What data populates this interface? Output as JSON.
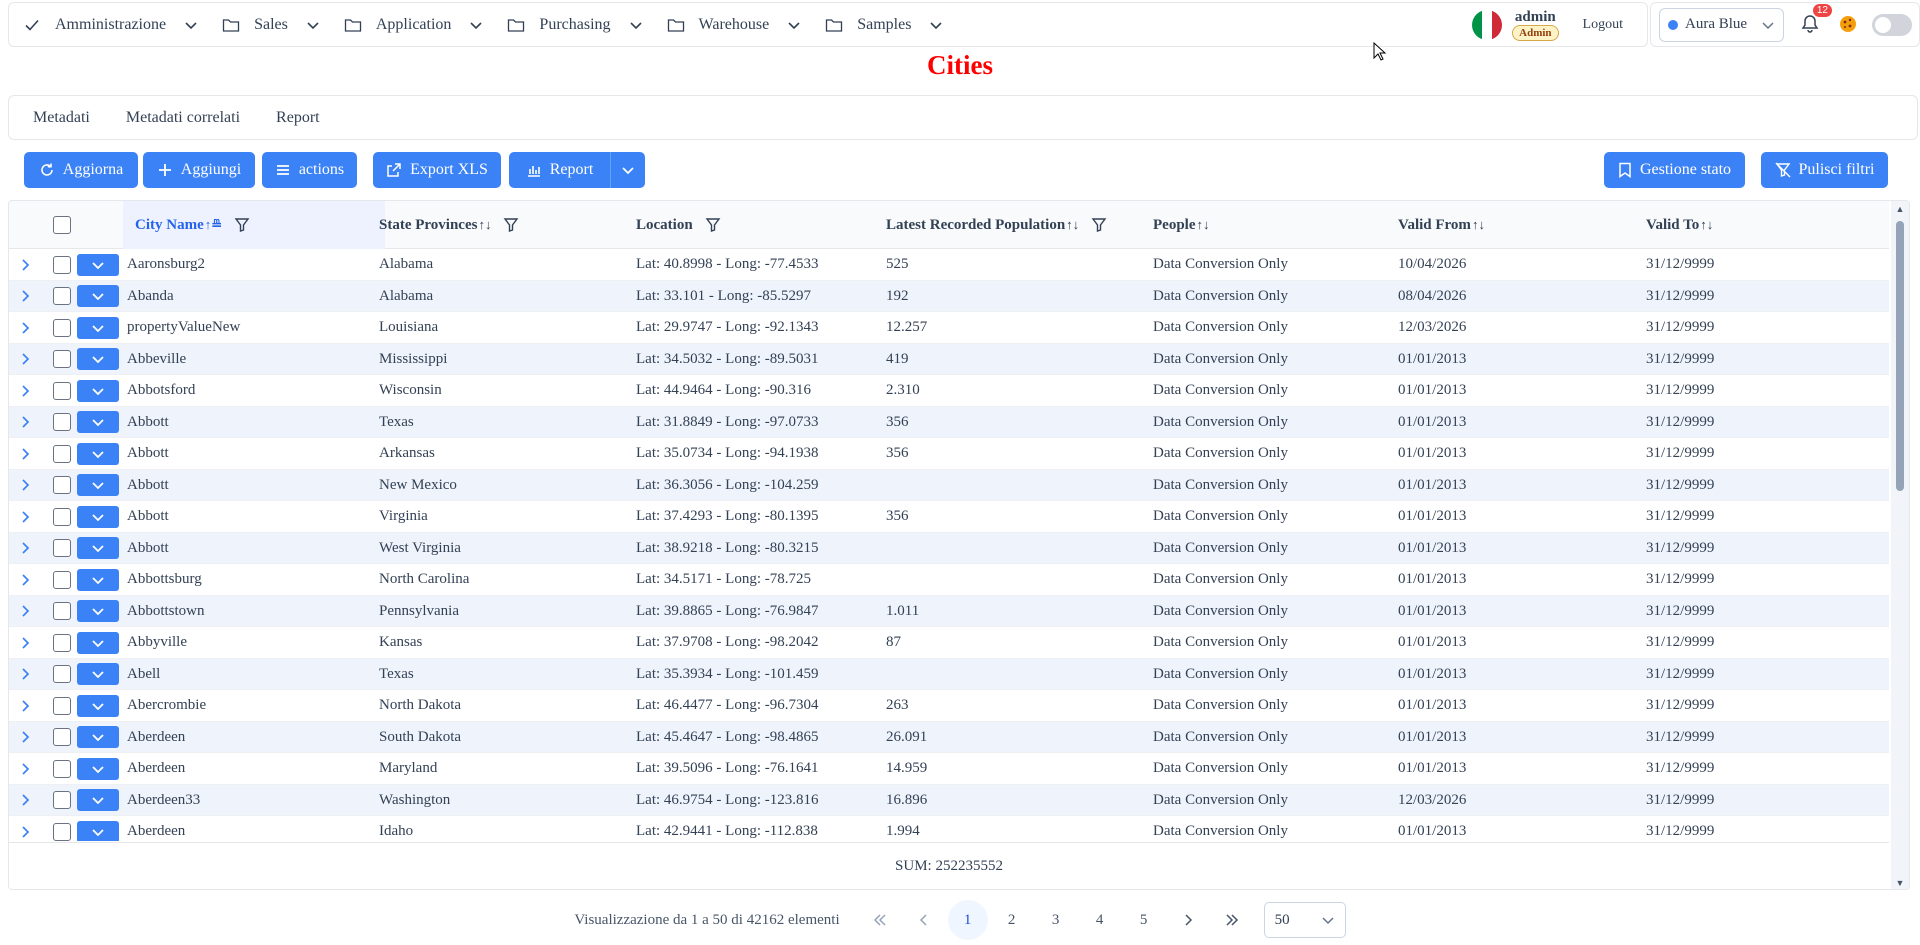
{
  "nav": {
    "items": [
      {
        "label": "Amministrazione",
        "icon": "check-icon"
      },
      {
        "label": "Sales",
        "icon": "folder-icon"
      },
      {
        "label": "Application",
        "icon": "folder-icon"
      },
      {
        "label": "Purchasing",
        "icon": "folder-icon"
      },
      {
        "label": "Warehouse",
        "icon": "folder-icon"
      },
      {
        "label": "Samples",
        "icon": "folder-icon"
      }
    ],
    "user": "admin",
    "role": "Admin",
    "logout": "Logout",
    "theme": "Aura Blue",
    "notifications": "12"
  },
  "page": {
    "title": "Cities"
  },
  "tabs": [
    "Metadati",
    "Metadati correlati",
    "Report"
  ],
  "toolbar": {
    "refresh": "Aggiorna",
    "add": "Aggiungi",
    "actions": "actions",
    "export": "Export XLS",
    "report": "Report",
    "state": "Gestione stato",
    "clear": "Pulisci filtri"
  },
  "columns": {
    "city": "City Name",
    "state": "State Provinces",
    "location": "Location",
    "population": "Latest Recorded Population",
    "people": "People",
    "valid_from": "Valid From",
    "valid_to": "Valid To"
  },
  "rows": [
    [
      "Aaronsburg2",
      "Alabama",
      "Lat: 40.8998 - Long: -77.4533",
      "525",
      "Data Conversion Only",
      "10/04/2026",
      "31/12/9999"
    ],
    [
      "Abanda",
      "Alabama",
      "Lat: 33.101 - Long: -85.5297",
      "192",
      "Data Conversion Only",
      "08/04/2026",
      "31/12/9999"
    ],
    [
      "propertyValueNew",
      "Louisiana",
      "Lat: 29.9747 - Long: -92.1343",
      "12.257",
      "Data Conversion Only",
      "12/03/2026",
      "31/12/9999"
    ],
    [
      "Abbeville",
      "Mississippi",
      "Lat: 34.5032 - Long: -89.5031",
      "419",
      "Data Conversion Only",
      "01/01/2013",
      "31/12/9999"
    ],
    [
      "Abbotsford",
      "Wisconsin",
      "Lat: 44.9464 - Long: -90.316",
      "2.310",
      "Data Conversion Only",
      "01/01/2013",
      "31/12/9999"
    ],
    [
      "Abbott",
      "Texas",
      "Lat: 31.8849 - Long: -97.0733",
      "356",
      "Data Conversion Only",
      "01/01/2013",
      "31/12/9999"
    ],
    [
      "Abbott",
      "Arkansas",
      "Lat: 35.0734 - Long: -94.1938",
      "356",
      "Data Conversion Only",
      "01/01/2013",
      "31/12/9999"
    ],
    [
      "Abbott",
      "New Mexico",
      "Lat: 36.3056 - Long: -104.259",
      "",
      "Data Conversion Only",
      "01/01/2013",
      "31/12/9999"
    ],
    [
      "Abbott",
      "Virginia",
      "Lat: 37.4293 - Long: -80.1395",
      "356",
      "Data Conversion Only",
      "01/01/2013",
      "31/12/9999"
    ],
    [
      "Abbott",
      "West Virginia",
      "Lat: 38.9218 - Long: -80.3215",
      "",
      "Data Conversion Only",
      "01/01/2013",
      "31/12/9999"
    ],
    [
      "Abbottsburg",
      "North Carolina",
      "Lat: 34.5171 - Long: -78.725",
      "",
      "Data Conversion Only",
      "01/01/2013",
      "31/12/9999"
    ],
    [
      "Abbottstown",
      "Pennsylvania",
      "Lat: 39.8865 - Long: -76.9847",
      "1.011",
      "Data Conversion Only",
      "01/01/2013",
      "31/12/9999"
    ],
    [
      "Abbyville",
      "Kansas",
      "Lat: 37.9708 - Long: -98.2042",
      "87",
      "Data Conversion Only",
      "01/01/2013",
      "31/12/9999"
    ],
    [
      "Abell",
      "Texas",
      "Lat: 35.3934 - Long: -101.459",
      "",
      "Data Conversion Only",
      "01/01/2013",
      "31/12/9999"
    ],
    [
      "Abercrombie",
      "North Dakota",
      "Lat: 46.4477 - Long: -96.7304",
      "263",
      "Data Conversion Only",
      "01/01/2013",
      "31/12/9999"
    ],
    [
      "Aberdeen",
      "South Dakota",
      "Lat: 45.4647 - Long: -98.4865",
      "26.091",
      "Data Conversion Only",
      "01/01/2013",
      "31/12/9999"
    ],
    [
      "Aberdeen",
      "Maryland",
      "Lat: 39.5096 - Long: -76.1641",
      "14.959",
      "Data Conversion Only",
      "01/01/2013",
      "31/12/9999"
    ],
    [
      "Aberdeen33",
      "Washington",
      "Lat: 46.9754 - Long: -123.816",
      "16.896",
      "Data Conversion Only",
      "12/03/2026",
      "31/12/9999"
    ],
    [
      "Aberdeen",
      "Idaho",
      "Lat: 42.9441 - Long: -112.838",
      "1.994",
      "Data Conversion Only",
      "01/01/2013",
      "31/12/9999"
    ]
  ],
  "summary": "SUM: 252235552",
  "pagination": {
    "info": "Visualizzazione da 1 a 50 di 42162 elementi",
    "pages": [
      "1",
      "2",
      "3",
      "4",
      "5"
    ],
    "current": "1",
    "page_size": "50"
  },
  "colors": {
    "accent": "#3b82f6",
    "title": "#ff0000",
    "row_alt": "#eff4fc"
  }
}
